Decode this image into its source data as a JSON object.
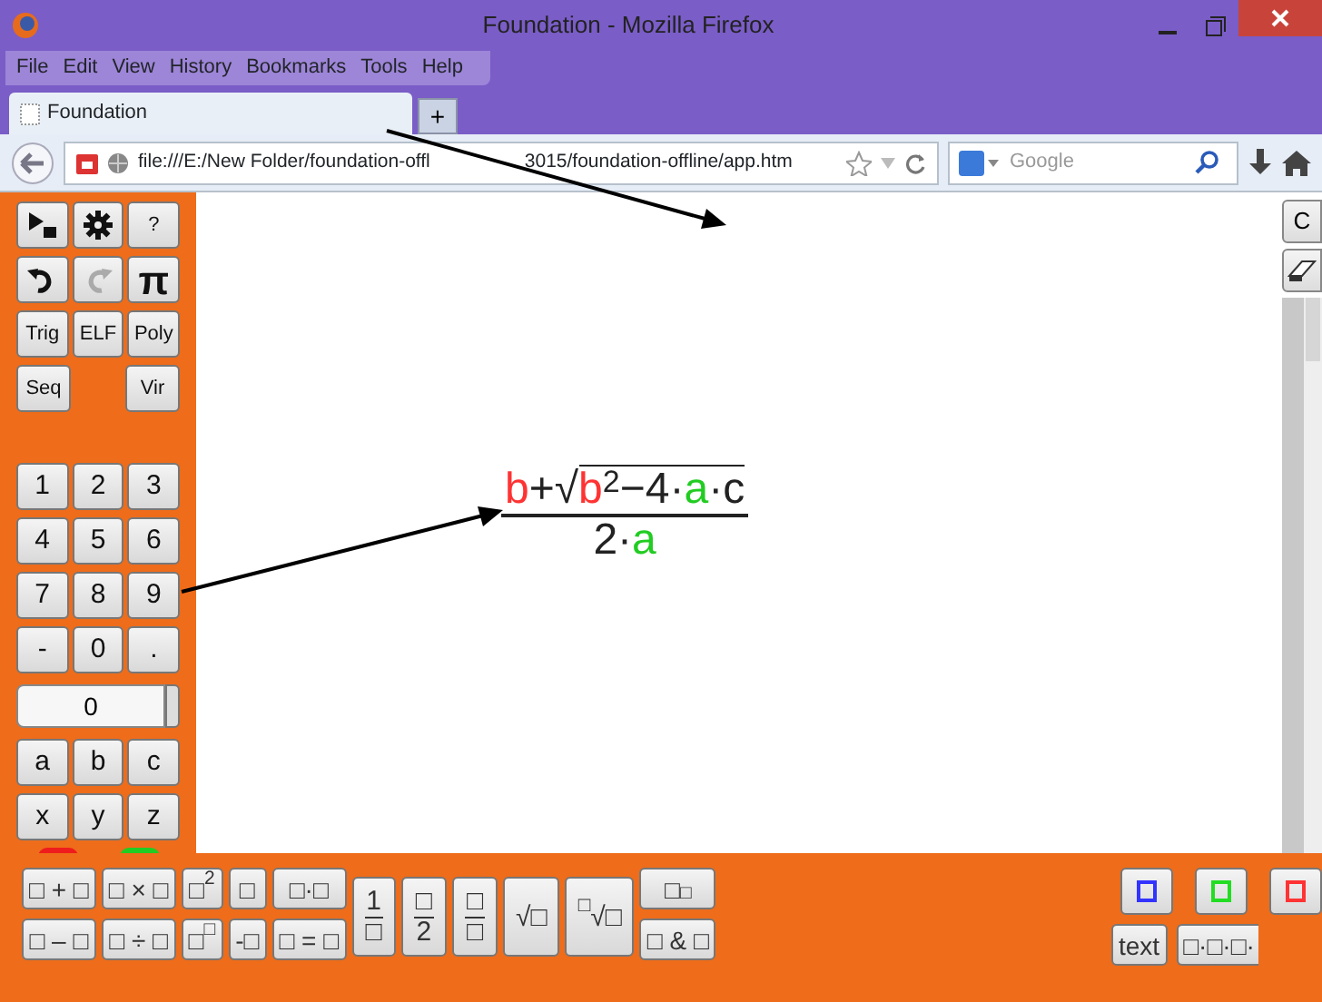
{
  "window": {
    "title": "Foundation - Mozilla Firefox"
  },
  "menu": [
    "File",
    "Edit",
    "View",
    "History",
    "Bookmarks",
    "Tools",
    "Help"
  ],
  "tabs": [
    {
      "label": "Foundation",
      "selected": true
    }
  ],
  "new_tab": "+",
  "address": {
    "url_start": "file:///E:/New Folder/foundation-offl",
    "url_end": "3015/foundation-offline/app.htm"
  },
  "search": {
    "placeholder": "Google"
  },
  "left_panel": {
    "tool_rows": [
      [
        {
          "kind": "icon",
          "disabled": false
        },
        {
          "kind": "icon",
          "disabled": false
        },
        {
          "kind": "text",
          "label": "?"
        }
      ],
      [
        {
          "kind": "icon",
          "disabled": false
        },
        {
          "kind": "icon",
          "disabled": true
        },
        {
          "kind": "symbol",
          "label": "π"
        }
      ],
      [
        {
          "kind": "text",
          "label": "Trig"
        },
        {
          "kind": "text",
          "label": "ELF"
        },
        {
          "kind": "text",
          "label": "Poly"
        }
      ],
      [
        {
          "kind": "text",
          "label": "Seq"
        },
        {
          "kind": "text",
          "label": "Vir"
        }
      ]
    ],
    "keypad": [
      [
        "1",
        "2",
        "3"
      ],
      [
        "4",
        "5",
        "6"
      ],
      [
        "7",
        "8",
        "9"
      ],
      [
        "-",
        "0",
        "."
      ]
    ],
    "number_field": {
      "value": "0"
    },
    "variables": [
      [
        "a",
        "b",
        "c"
      ],
      [
        "x",
        "y",
        "z"
      ]
    ],
    "color_tabs": [
      {
        "color": "#ee1c1c"
      },
      {
        "color": "#22cc22"
      }
    ]
  },
  "side_buttons": {
    "clear": "C"
  },
  "formula": {
    "numerator": [
      {
        "kind": "var",
        "text": "b",
        "color": "#ff3333"
      },
      {
        "kind": "op",
        "text": "+"
      },
      {
        "kind": "sqrt",
        "symbol": "√",
        "children": [
          {
            "kind": "var",
            "text": "b",
            "color": "#ff3333"
          },
          {
            "kind": "sup",
            "text": "2"
          },
          {
            "kind": "op",
            "text": "−4·"
          },
          {
            "kind": "var",
            "text": "a",
            "color": "#22cc22"
          },
          {
            "kind": "op",
            "text": "·c"
          }
        ]
      }
    ],
    "denominator": [
      {
        "kind": "op",
        "text": "2·"
      },
      {
        "kind": "var",
        "text": "a",
        "color": "#22cc22"
      }
    ]
  },
  "toolbar": {
    "columns": [
      {
        "kind": "pair",
        "items": [
          "□ + □",
          "□ – □"
        ]
      },
      {
        "kind": "pair",
        "items": [
          "□ × □",
          "□ ÷ □"
        ]
      },
      {
        "kind": "pair",
        "items": [
          "□$^{2}$",
          "□$^{□}$"
        ]
      },
      {
        "kind": "pair",
        "items": [
          "□",
          "-□"
        ]
      },
      {
        "kind": "pair",
        "items": [
          "□·□",
          "□ = □"
        ]
      },
      {
        "kind": "fraction",
        "num": "1",
        "den": "□"
      },
      {
        "kind": "fraction",
        "num": "□",
        "den": "2"
      },
      {
        "kind": "fraction",
        "num": "□",
        "den": "□"
      },
      {
        "kind": "tall",
        "text": "√□"
      },
      {
        "kind": "tall",
        "text": "$^{□}$√□"
      },
      {
        "kind": "pair",
        "items": [
          "□$_{□}$",
          "□ & □"
        ]
      }
    ],
    "colors": [
      {
        "color": "#3333ff"
      },
      {
        "color": "#22dd22"
      },
      {
        "color": "#ff3333"
      }
    ],
    "text_button": "text",
    "product_button": "□·□·□·"
  }
}
